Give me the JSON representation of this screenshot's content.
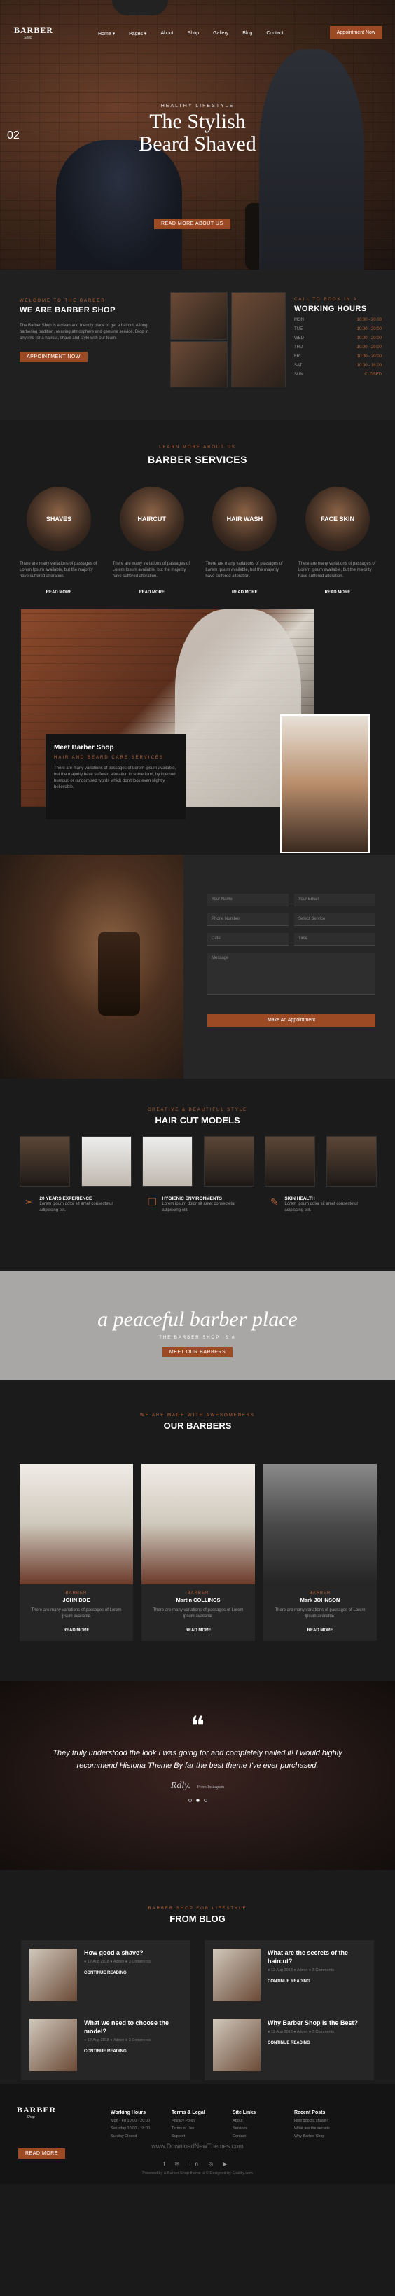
{
  "header": {
    "logo_text": "BARBER",
    "logo_sub": "Shop",
    "nav": [
      "Home ▾",
      "Pages ▾",
      "About",
      "Shop",
      "Gallery",
      "Blog",
      "Contact"
    ],
    "appointment": "Appointment Now"
  },
  "hero": {
    "slide_number": "02",
    "kicker": "HEALTHY LIFESTYLE",
    "title_line1": "The Stylish",
    "title_line2": "Beard Shaved",
    "button": "READ MORE ABOUT US"
  },
  "welcome": {
    "kicker": "WELCOME TO THE BARBER",
    "title": "WE ARE BARBER SHOP",
    "text": "The Barber Shop is a clean and friendly place to get a haircut. A long barbering tradition, relaxing atmosphere and genuine service. Drop in anytime for a haircut, shave and style with our team.",
    "button": "Appointment Now",
    "hours_kicker": "CALL TO BOOK IN A",
    "hours_title": "WORKING HOURS",
    "hours": [
      {
        "day": "MON",
        "time": "10:00 - 20:00"
      },
      {
        "day": "TUE",
        "time": "10:00 - 20:00"
      },
      {
        "day": "WED",
        "time": "10:00 - 20:00"
      },
      {
        "day": "THU",
        "time": "10:00 - 20:00"
      },
      {
        "day": "FRI",
        "time": "10:00 - 20:00"
      },
      {
        "day": "SAT",
        "time": "10:00 - 18:00"
      },
      {
        "day": "SUN",
        "time": "CLOSED"
      }
    ]
  },
  "services": {
    "kicker": "LEARN MORE ABOUT US",
    "title": "BARBER SERVICES",
    "items": [
      {
        "name": "SHAVES",
        "desc": "There are many variations of passages of Lorem Ipsum available, but the majority have suffered alteration.",
        "more": "READ MORE"
      },
      {
        "name": "HAIRCUT",
        "desc": "There are many variations of passages of Lorem Ipsum available, but the majority have suffered alteration.",
        "more": "READ MORE"
      },
      {
        "name": "HAIR WASH",
        "desc": "There are many variations of passages of Lorem Ipsum available, but the majority have suffered alteration.",
        "more": "READ MORE"
      },
      {
        "name": "FACE SKIN",
        "desc": "There are many variations of passages of Lorem Ipsum available, but the majority have suffered alteration.",
        "more": "READ MORE"
      }
    ]
  },
  "meet": {
    "title": "Meet Barber Shop",
    "kicker": "HAIR AND BEARD CARE SERVICES",
    "text": "There are many variations of passages of Lorem Ipsum available, but the majority have suffered alteration in some form, by injected humour, or randomised words which don't look even slightly believable."
  },
  "form": {
    "name": "Your Name",
    "email": "Your Email",
    "phone": "Phone Number",
    "service": "Select Service",
    "date": "Date",
    "time": "Time",
    "message": "Message",
    "button": "Make An Appointment"
  },
  "haircut": {
    "kicker": "CREATIVE & BEAUTIFUL STYLE",
    "title": "HAIR CUT MODELS",
    "features": [
      {
        "icon": "scissors-icon",
        "glyph": "✂",
        "title": "20 YEARS EXPERIENCE",
        "desc": "Lorem ipsum dolor sit amet consectetur adipiscing elit."
      },
      {
        "icon": "bottle-icon",
        "glyph": "❐",
        "title": "HYGIENIC ENVIRONMENTS",
        "desc": "Lorem ipsum dolor sit amet consectetur adipiscing elit."
      },
      {
        "icon": "razor-icon",
        "glyph": "✎",
        "title": "SKIN HEALTH",
        "desc": "Lorem ipsum dolor sit amet consectetur adipiscing elit."
      }
    ]
  },
  "peace": {
    "title": "a peaceful barber place",
    "sub": "THE BARBER SHOP IS A",
    "button": "MEET OUR BARBERS"
  },
  "barbers": {
    "kicker": "WE ARE MADE WITH AWESOMENESS",
    "title": "OUR BARBERS",
    "items": [
      {
        "role": "BARBER",
        "name": "JOHN DOE",
        "desc": "There are many variations of passages of Lorem Ipsum available.",
        "more": "READ MORE"
      },
      {
        "role": "BARBER",
        "name": "Martin COLLINCS",
        "desc": "There are many variations of passages of Lorem Ipsum available.",
        "more": "READ MORE"
      },
      {
        "role": "BARBER",
        "name": "Mark JOHNSON",
        "desc": "There are many variations of passages of Lorem Ipsum available.",
        "more": "READ MORE"
      }
    ]
  },
  "testimonial": {
    "quote_mark": "❝",
    "text": "They truly understood the look I was going for and completely nailed it! I would highly recommend Historia Theme By far the best theme I've ever purchased.",
    "signature": "Rdly.",
    "source": "From Instagram"
  },
  "blog": {
    "kicker": "BARBER SHOP FOR LIFESTYLE",
    "title": "FROM BLOG",
    "posts": [
      {
        "title": "How good a shave?",
        "meta": "● 12 Aug 2018   ● Admin   ● 3 Comments",
        "more": "CONTINUE READING"
      },
      {
        "title": "What are the secrets of the haircut?",
        "meta": "● 12 Aug 2018   ● Admin   ● 3 Comments",
        "more": "CONTINUE READING"
      },
      {
        "title": "What we need to choose the model?",
        "meta": "● 12 Aug 2018   ● Admin   ● 3 Comments",
        "more": "CONTINUE READING"
      },
      {
        "title": "Why Barber Shop is the Best?",
        "meta": "● 12 Aug 2018   ● Admin   ● 3 Comments",
        "more": "CONTINUE READING"
      }
    ]
  },
  "footer": {
    "logo_text": "BARBER",
    "logo_sub": "Shop",
    "button": "Read More",
    "columns": [
      {
        "title": "Working Hours",
        "items": [
          "Mon - Fri 10:00 - 20:00",
          "Saturday 10:00 - 18:00",
          "Sunday Closed"
        ]
      },
      {
        "title": "Terms & Legal",
        "items": [
          "Privacy Policy",
          "Terms of Use",
          "Support"
        ]
      },
      {
        "title": "Site Links",
        "items": [
          "About",
          "Services",
          "Contact"
        ]
      },
      {
        "title": "Recent Posts",
        "items": [
          "How good a shave?",
          "What are the secrets",
          "Why Barber Shop"
        ]
      }
    ],
    "watermark": "www.DownloadNewThemes.com",
    "social": "f ✉ in ◎ ▶",
    "copyright": "Powered by & Barber Shop theme is © Designed by Epaliky.com"
  },
  "colors": {
    "accent": "#9c4a24",
    "background": "#1b1b1b"
  }
}
